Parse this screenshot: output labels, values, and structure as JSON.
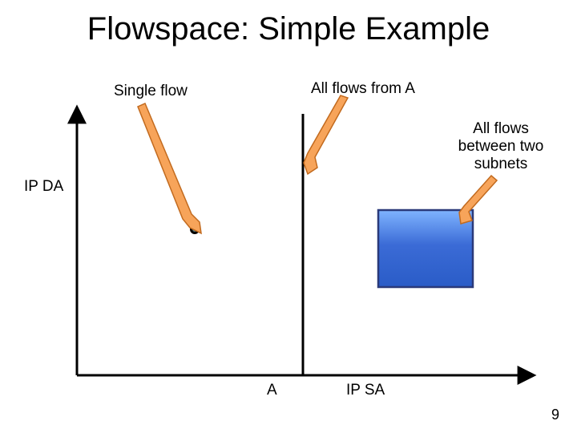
{
  "title": "Flowspace: Simple Example",
  "labels": {
    "single_flow": "Single flow",
    "all_flows_from_A": "All flows from A",
    "all_flows_between_two_subnets": "All flows\nbetween two\nsubnets"
  },
  "axes": {
    "y": "IP DA",
    "x": "IP SA",
    "x_tick_A": "A"
  },
  "page_number": "9",
  "colors": {
    "arrow_fill": "#f7a45a",
    "arrow_stroke": "#c26a1e",
    "axis": "#000000",
    "box_border": "#2b3a7a",
    "box_top": "#6aa6ff",
    "box_mid": "#3b6bd6",
    "box_bot": "#1d4fb0",
    "dot_outer": "#000000",
    "dot_inner": "#5b7f7f"
  },
  "chart_data": {
    "type": "scatter",
    "xlabel": "IP SA",
    "ylabel": "IP DA",
    "title": "Flowspace: Simple Example",
    "xlim": [
      0,
      10
    ],
    "ylim": [
      0,
      10
    ],
    "series": [
      {
        "name": "Single flow",
        "kind": "point",
        "x": [
          2.8
        ],
        "y": [
          5.8
        ]
      },
      {
        "name": "All flows from A",
        "kind": "vline",
        "x": 5.0,
        "y_range": [
          0,
          10
        ]
      },
      {
        "name": "All flows between two subnets",
        "kind": "rect",
        "x_range": [
          6.2,
          8.4
        ],
        "y_range": [
          4.0,
          6.2
        ]
      }
    ],
    "x_ticks": [
      {
        "value": 5.0,
        "label": "A"
      }
    ]
  }
}
